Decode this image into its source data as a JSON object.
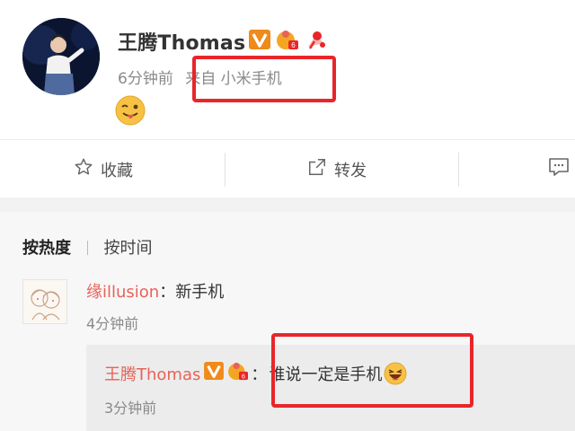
{
  "post": {
    "author": "王腾Thomas",
    "time": "6分钟前",
    "source_prefix": "来自",
    "source_device": "小米手机",
    "badges": [
      "verified-v-icon",
      "level-badge-icon",
      "fan-badge-icon"
    ],
    "content_emoji": "wink-tongue-emoji"
  },
  "actions": {
    "favorite": "收藏",
    "repost": "转发",
    "comment_icon": "comment-icon"
  },
  "comments": {
    "sort_hot": "按热度",
    "sort_time": "按时间",
    "items": [
      {
        "user": "缘illusion",
        "separator": "：",
        "text": "新手机",
        "time": "4分钟前",
        "reply": {
          "user": "王腾Thomas",
          "separator": "：",
          "text": "谁说一定是手机",
          "emoji": "laughing-emoji",
          "time": "3分钟前"
        }
      }
    ]
  },
  "colors": {
    "highlight": "#e8262a",
    "username": "#e8625a",
    "muted": "#8a8a8a"
  }
}
